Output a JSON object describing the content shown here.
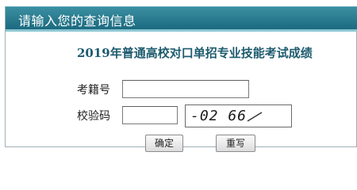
{
  "header": {
    "title": "请输入您的查询信息"
  },
  "form": {
    "heading": "2019年普通高校对口单招专业技能考试成绩",
    "exam_no_label": "考籍号",
    "exam_no_value": "",
    "captcha_label": "校验码",
    "captcha_value": "",
    "captcha_image_text": "-02 66"
  },
  "buttons": {
    "submit_label": "确定",
    "reset_label": "重写"
  },
  "colors": {
    "header_bg": "#1b6a80",
    "heading_text": "#1d5b6e"
  }
}
